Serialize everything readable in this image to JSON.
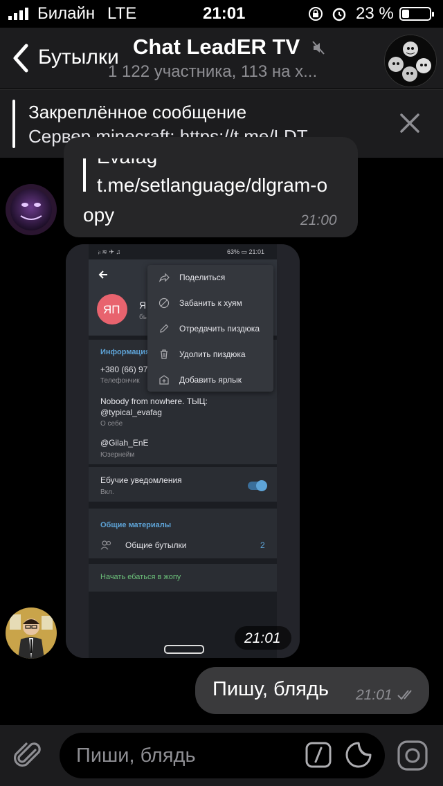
{
  "status_bar": {
    "carrier": "Билайн",
    "network": "LTE",
    "time": "21:01",
    "battery": "23 %"
  },
  "header": {
    "back_label": "Бутылки",
    "title": "Chat LeadER TV",
    "subtitle": "1 122 участника, 113 на х..."
  },
  "pinned": {
    "title": "Закреплённое сообщение",
    "text": "Сервер minecraft: https://t.me/LDT..."
  },
  "messages": [
    {
      "quote_author": "Evafag",
      "quote_text": "t.me/setlanguage/dlgram-o",
      "text": "opy",
      "time": "21:00"
    }
  ],
  "screenshot": {
    "status_left": "ᵢₗ ≋ ✈ ♫",
    "status_right": "63% ▭ 21:01",
    "avatar_initials": "ЯП",
    "name_partial": "Я",
    "name_sub_partial": "бь",
    "menu": [
      {
        "label": "Поделиться",
        "icon": "share-icon"
      },
      {
        "label": "Забанить к хуям",
        "icon": "block-icon"
      },
      {
        "label": "Отредачить пиздюка",
        "icon": "edit-icon"
      },
      {
        "label": "Удолить пиздюка",
        "icon": "trash-icon"
      },
      {
        "label": "Добавить ярлык",
        "icon": "add-shortcut-icon"
      }
    ],
    "info_header": "Информация",
    "phone": "+380 (66) 97",
    "phone_label": "Телефончик",
    "bio": "Nobody from nowhere. ТЫЦ:",
    "bio2": "@typical_evafag",
    "bio_label": "О себе",
    "username": "@Gilah_EnE",
    "username_label": "Юзернейм",
    "notif": "Ебучие уведомления",
    "notif_state": "Вкл.",
    "shared_header": "Общие материалы",
    "shared_groups": "Общие бутылки",
    "shared_count": "2",
    "start_chat": "Начать ебаться в жопу",
    "time": "21:01"
  },
  "outgoing": {
    "text": "Пишу, блядь",
    "time": "21:01"
  },
  "input": {
    "placeholder": "Пиши, блядь"
  },
  "colors": {
    "bg": "#000000",
    "bar": "#1c1c1e",
    "bubble_in": "#262628",
    "bubble_out": "#3a3a3c",
    "accent": "#5ea4d8",
    "green": "#6cc07a"
  }
}
